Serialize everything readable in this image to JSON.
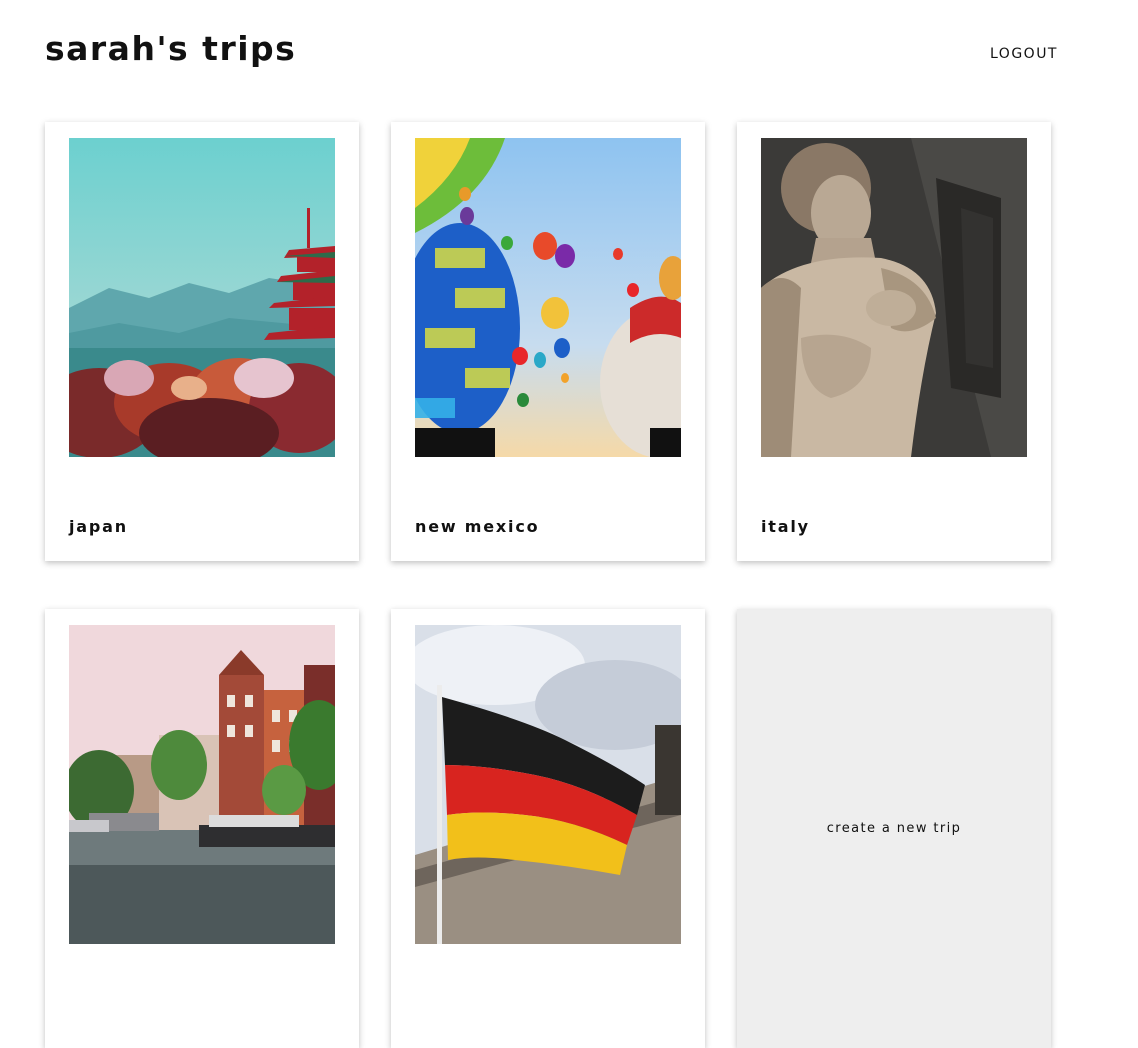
{
  "header": {
    "title": "sarah's trips",
    "logout_label": "LOGOUT"
  },
  "trips": [
    {
      "name": "japan",
      "image_alt": "pagoda-photo"
    },
    {
      "name": "new mexico",
      "image_alt": "hot-air-balloons-photo"
    },
    {
      "name": "italy",
      "image_alt": "statue-photo"
    },
    {
      "name": "",
      "image_alt": "canal-houses-photo"
    },
    {
      "name": "",
      "image_alt": "german-flag-photo"
    }
  ],
  "create_card": {
    "label": "create a new trip"
  }
}
